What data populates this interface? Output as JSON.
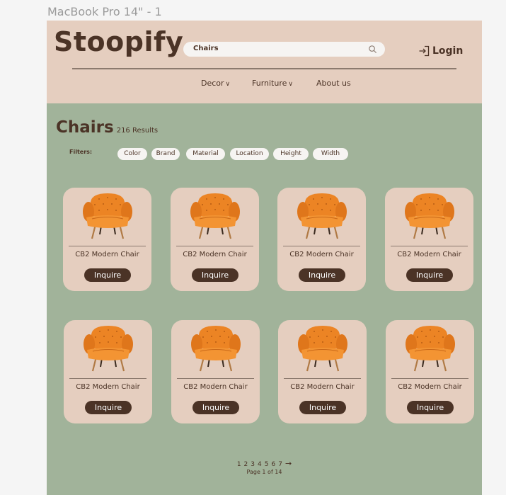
{
  "frame_label": "MacBook Pro 14\" - 1",
  "header": {
    "logo": "Stoopify",
    "search": {
      "value": "Chairs",
      "icon": "search-icon"
    },
    "login": {
      "label": "Login",
      "icon": "login-icon"
    },
    "nav": [
      {
        "label": "Decor",
        "has_dropdown": true
      },
      {
        "label": "Furniture",
        "has_dropdown": true
      },
      {
        "label": "About us",
        "has_dropdown": false
      }
    ]
  },
  "results": {
    "title": "Chairs",
    "count": "216 Results"
  },
  "filters": {
    "label": "Filters:",
    "chips": [
      "Color",
      "Brand",
      "Material",
      "Location",
      "Height",
      "Width"
    ]
  },
  "products": [
    {
      "name": "CB2 Modern Chair",
      "button": "Inquire"
    },
    {
      "name": "CB2 Modern Chair",
      "button": "Inquire"
    },
    {
      "name": "CB2 Modern Chair",
      "button": "Inquire"
    },
    {
      "name": "CB2 Modern Chair",
      "button": "Inquire"
    },
    {
      "name": "CB2 Modern Chair",
      "button": "Inquire"
    },
    {
      "name": "CB2 Modern Chair",
      "button": "Inquire"
    },
    {
      "name": "CB2 Modern Chair",
      "button": "Inquire"
    },
    {
      "name": "CB2 Modern Chair",
      "button": "Inquire"
    }
  ],
  "pagination": {
    "pages": [
      "1",
      "2",
      "3",
      "4",
      "5",
      "6",
      "7"
    ],
    "next": "→",
    "info": "Page 1 of 14"
  },
  "colors": {
    "header_bg": "#e5cebf",
    "page_bg": "#a1b39a",
    "brand_brown": "#4b3326",
    "chip_bg": "#f6f4f2",
    "chair_orange": "#e8801f"
  }
}
